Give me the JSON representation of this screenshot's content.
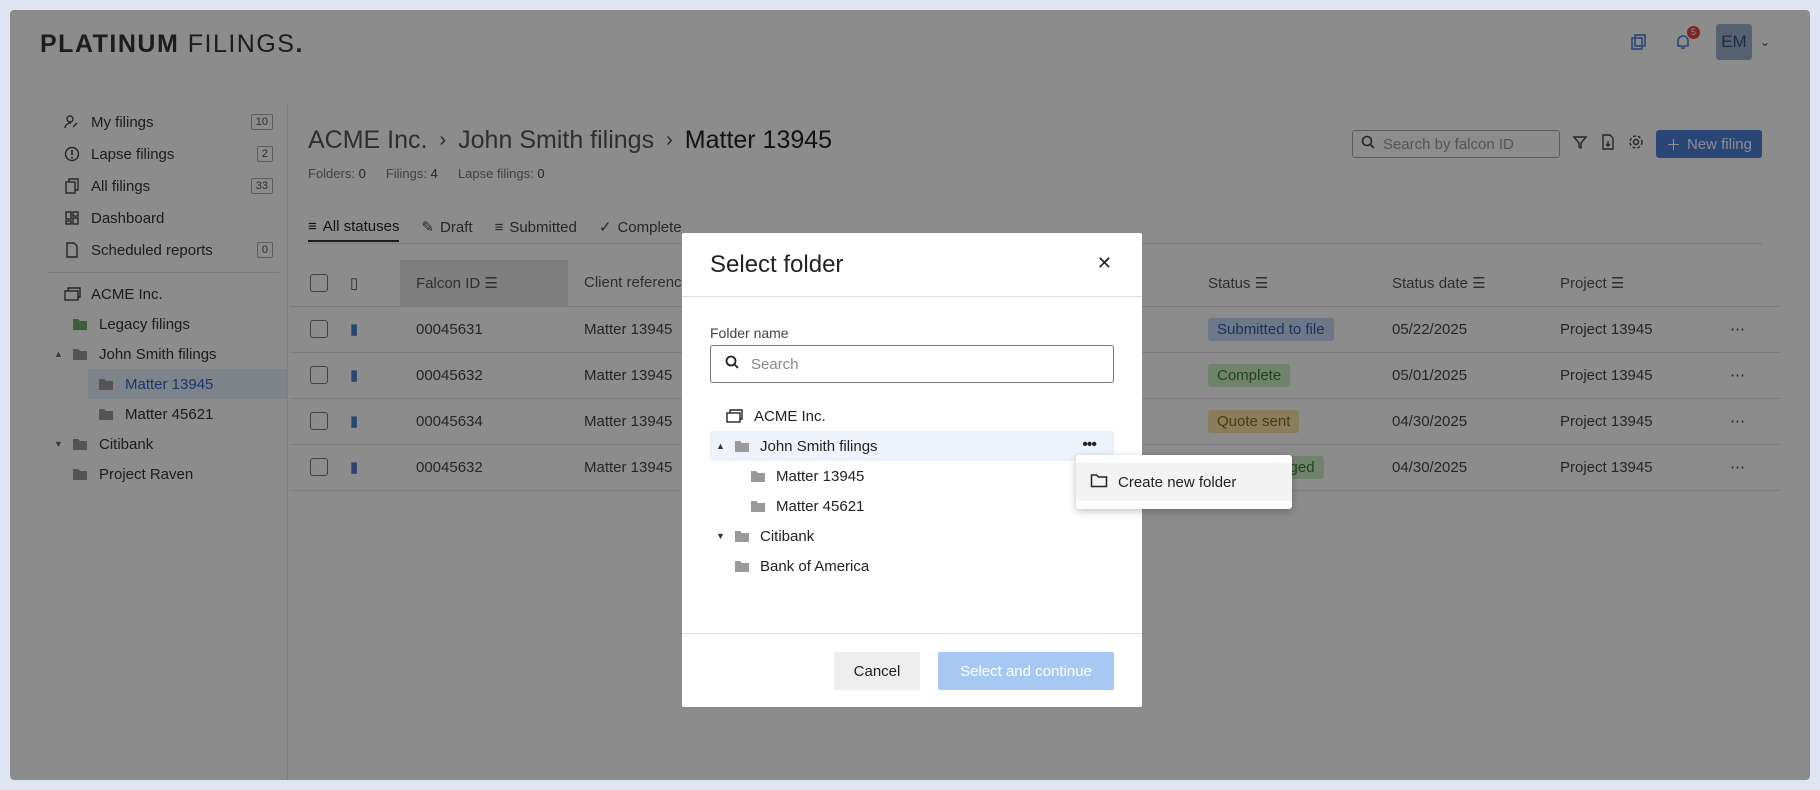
{
  "app": {
    "logo_bold": "PLATINUM",
    "logo_rest": " FILINGS",
    "logo_dot": "."
  },
  "header": {
    "notification_count": "5",
    "avatar_initials": "EM"
  },
  "sidebar": {
    "nav": [
      {
        "label": "My filings",
        "count": "10",
        "icon": "user-pen-icon"
      },
      {
        "label": "Lapse filings",
        "count": "2",
        "icon": "alert-circle-icon"
      },
      {
        "label": "All filings",
        "count": "33",
        "icon": "copy-icon"
      },
      {
        "label": "Dashboard",
        "count": "",
        "icon": "dashboard-icon"
      },
      {
        "label": "Scheduled reports",
        "count": "0",
        "icon": "report-icon"
      }
    ],
    "tree": [
      {
        "label": "ACME Inc."
      },
      {
        "label": "Legacy filings"
      },
      {
        "label": "John Smith filings"
      },
      {
        "label": "Matter 13945"
      },
      {
        "label": "Matter 45621"
      },
      {
        "label": "Citibank"
      },
      {
        "label": "Project Raven"
      }
    ]
  },
  "main": {
    "breadcrumb": [
      "ACME Inc.",
      "John Smith filings",
      "Matter 13945"
    ],
    "counts": {
      "folders_label": "Folders:",
      "folders": "0",
      "filings_label": "Filings:",
      "filings": "4",
      "lapse_label": "Lapse filings:",
      "lapse": "0"
    },
    "search_placeholder": "Search by falcon ID",
    "new_filing_label": "New filing",
    "tabs": [
      "All statuses",
      "Draft",
      "Submitted",
      "Complete"
    ],
    "columns": [
      "Falcon ID",
      "Client referenc",
      "Status",
      "Status date",
      "Project"
    ],
    "rows": [
      {
        "id": "00045631",
        "client": "Matter 13945",
        "status": "Submitted to file",
        "status_bg": "#c7d9f5",
        "status_fg": "#2d5aa8",
        "date": "05/22/2025",
        "project": "Project 13945"
      },
      {
        "id": "00045632",
        "client": "Matter 13945",
        "status": "Complete",
        "status_bg": "#cdebc8",
        "status_fg": "#3a7a34",
        "date": "05/01/2025",
        "project": "Project 13945"
      },
      {
        "id": "00045634",
        "client": "Matter 13945",
        "status": "Quote sent",
        "status_bg": "#f7e3a8",
        "status_fg": "#8a6b12",
        "date": "04/30/2025",
        "project": "Project 13945"
      },
      {
        "id": "00045632",
        "client": "Matter 13945",
        "status": "Acknowledged",
        "status_bg": "#cdebc8",
        "status_fg": "#3a7a34",
        "date": "04/30/2025",
        "project": "Project 13945"
      }
    ]
  },
  "modal": {
    "title": "Select folder",
    "field_label": "Folder name",
    "search_placeholder": "Search",
    "tree": [
      {
        "label": "ACME Inc."
      },
      {
        "label": "John Smith filings"
      },
      {
        "label": "Matter 13945"
      },
      {
        "label": "Matter 45621"
      },
      {
        "label": "Citibank"
      },
      {
        "label": "Bank of America"
      }
    ],
    "cancel_label": "Cancel",
    "select_label": "Select and continue"
  },
  "context_menu": {
    "create_folder_label": "Create new folder"
  },
  "colors": {
    "accent": "#4a7fd8",
    "overlay": "rgba(0,0,0,0.45)",
    "disabled_button": "#a7c8f3"
  }
}
